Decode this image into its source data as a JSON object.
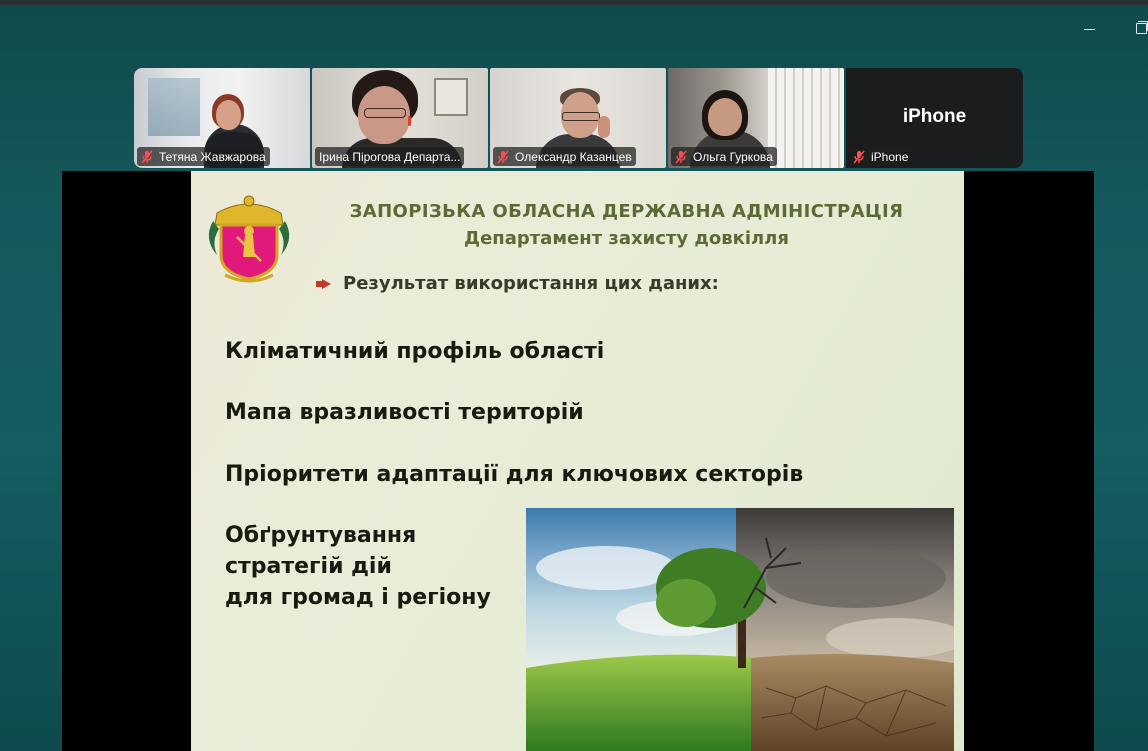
{
  "window_controls": {
    "minimize": "minimize",
    "restore": "restore"
  },
  "participants": [
    {
      "name": "Тетяна Жавжарова",
      "muted": true
    },
    {
      "name": "Ірина Пірогова Департа...",
      "muted": false,
      "active": true
    },
    {
      "name": "Олександр Казанцев",
      "muted": true
    },
    {
      "name": "Ольга Гуркова",
      "muted": true
    },
    {
      "name": "iPhone",
      "muted": true,
      "video_off_label": "iPhone"
    }
  ],
  "slide": {
    "org_line1": "ЗАПОРІЗЬКА ОБЛАСНА ДЕРЖАВНА АДМІНІСТРАЦІЯ",
    "org_line2": "Департамент захисту довкілля",
    "bullet": "Результат використання цих даних:",
    "items": [
      "Кліматичний профіль області",
      "Мапа вразливості територій",
      "Пріоритети адаптації для ключових секторів"
    ],
    "item4_lines": [
      "Обґрунтування",
      "стратегій дій",
      "для громад і регіону"
    ]
  },
  "colors": {
    "background": "#155d60",
    "active_border": "#2fd17a",
    "org_text": "#5c6a36",
    "bullet_arrow": "#c0392b"
  }
}
